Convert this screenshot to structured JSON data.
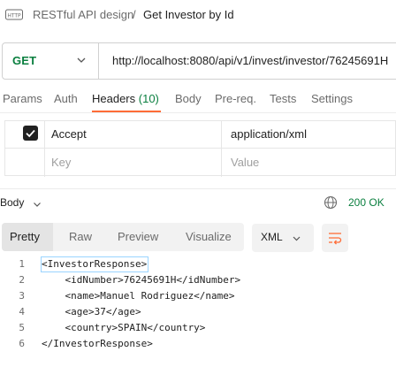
{
  "breadcrumb": {
    "icon": "http-icon",
    "icon_text": "HTTP",
    "parent": "RESTful API design",
    "separator": "/",
    "current": "Get Investor by Id"
  },
  "request": {
    "method": "GET",
    "url": "http://localhost:8080/api/v1/invest/investor/76245691H"
  },
  "request_tabs": [
    {
      "label": "Params"
    },
    {
      "label": "Auth"
    },
    {
      "label": "Headers",
      "count": "(10)",
      "active": true
    },
    {
      "label": "Body"
    },
    {
      "label": "Pre-req."
    },
    {
      "label": "Tests"
    },
    {
      "label": "Settings"
    }
  ],
  "headers_table": {
    "rows": [
      {
        "checked": true,
        "key": "Accept",
        "value": "application/xml"
      },
      {
        "checked": false,
        "key": "Key",
        "value": "Value",
        "placeholder": true
      }
    ]
  },
  "response": {
    "section_label": "Body",
    "status": "200 OK",
    "view_tabs": [
      "Pretty",
      "Raw",
      "Preview",
      "Visualize"
    ],
    "active_view": "Pretty",
    "format": "XML",
    "code_lines": [
      {
        "n": "1",
        "text": "<InvestorResponse>"
      },
      {
        "n": "2",
        "text": "    <idNumber>76245691H</idNumber>"
      },
      {
        "n": "3",
        "text": "    <name>Manuel Rodriguez</name>"
      },
      {
        "n": "4",
        "text": "    <age>37</age>"
      },
      {
        "n": "5",
        "text": "    <country>SPAIN</country>"
      },
      {
        "n": "6",
        "text": "</InvestorResponse>"
      }
    ]
  },
  "colors": {
    "method_green": "#0a7f3f",
    "accent_orange": "#ff6c37",
    "status_green": "#0a7f3f"
  }
}
